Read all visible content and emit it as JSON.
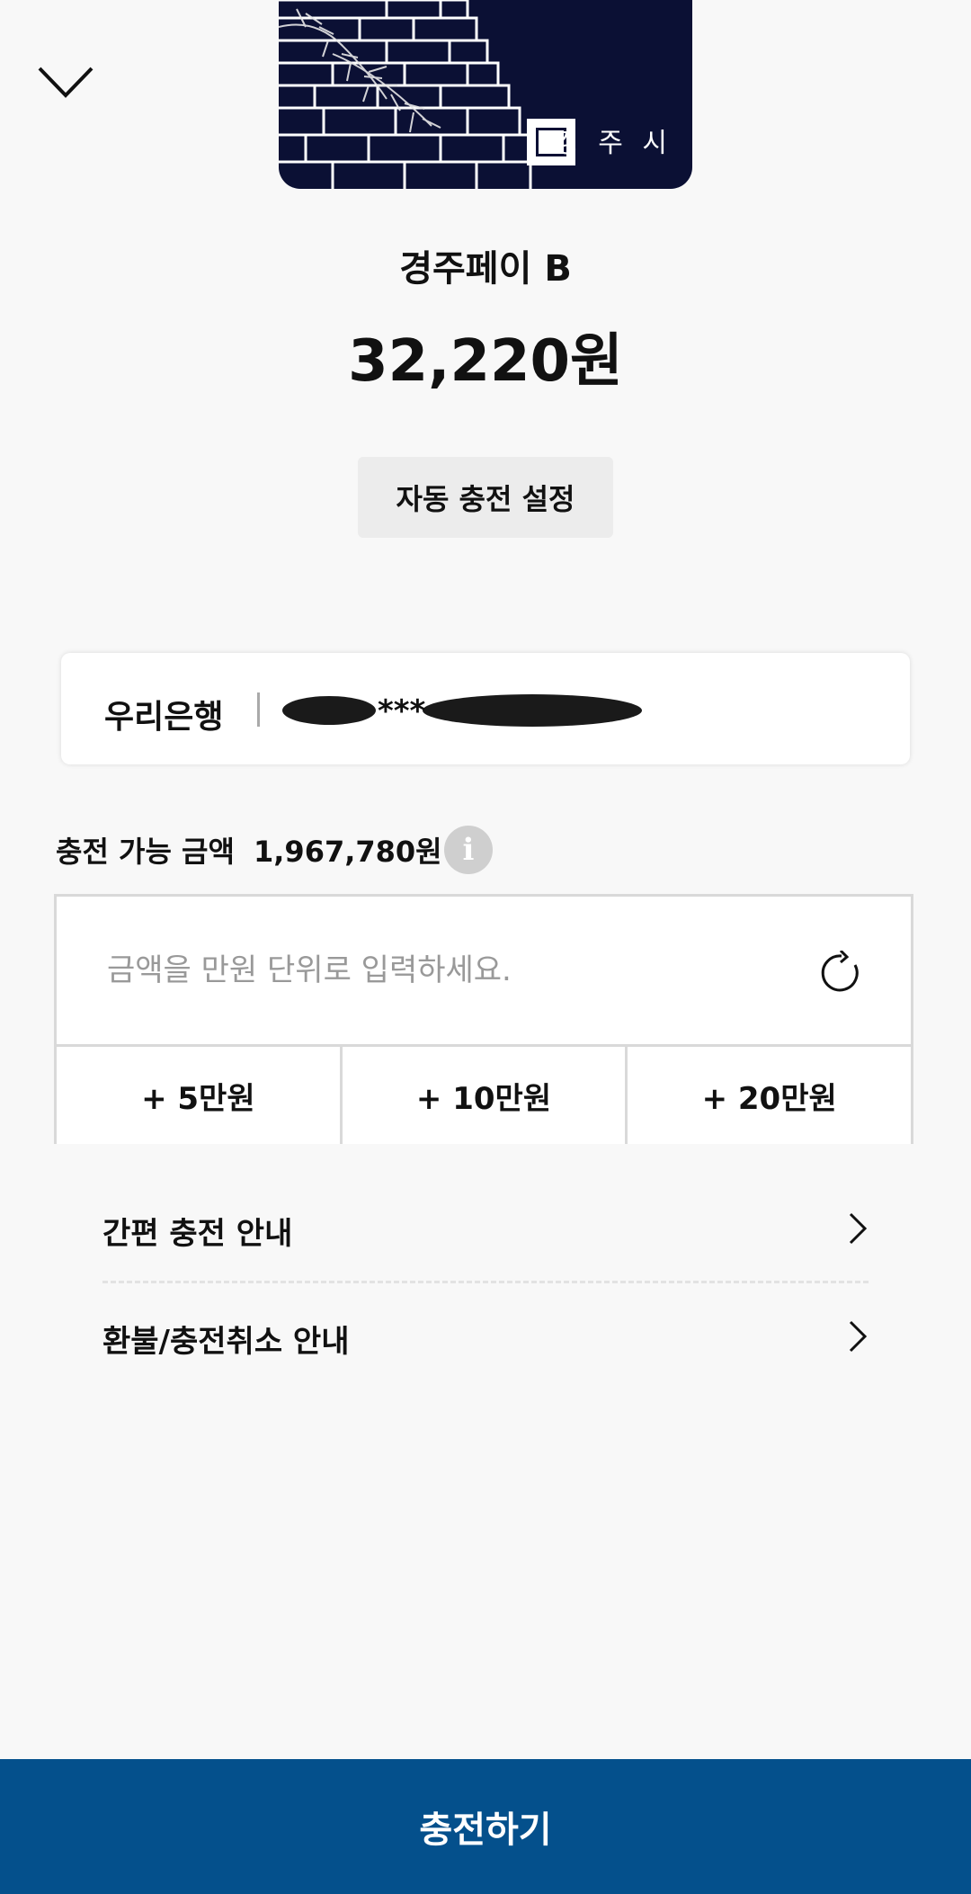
{
  "header": {
    "collapse_icon": "chevron-down-icon"
  },
  "card": {
    "city_label": "경 주 시",
    "name": "경주페이 B",
    "balance": "32,220원"
  },
  "auto_charge_label": "자동 충전 설정",
  "bank": {
    "name": "우리은행",
    "account_masked": "***"
  },
  "charge": {
    "available_label": "충전 가능 금액",
    "available_amount": "1,967,780원",
    "info_icon": "info-icon",
    "input_placeholder": "금액을 만원 단위로 입력하세요.",
    "refresh_icon": "refresh-icon",
    "quick_amounts": [
      "+ 5만원",
      "+ 10만원",
      "+ 20만원"
    ]
  },
  "menu": [
    {
      "label": "간편 충전 안내",
      "icon": "chevron-right-icon"
    },
    {
      "label": "환불/충전취소 안내",
      "icon": "chevron-right-icon"
    }
  ],
  "submit_label": "충전하기",
  "colors": {
    "primary": "#04508c",
    "card_navy": "#0b1034",
    "background": "#f8f8f8"
  }
}
